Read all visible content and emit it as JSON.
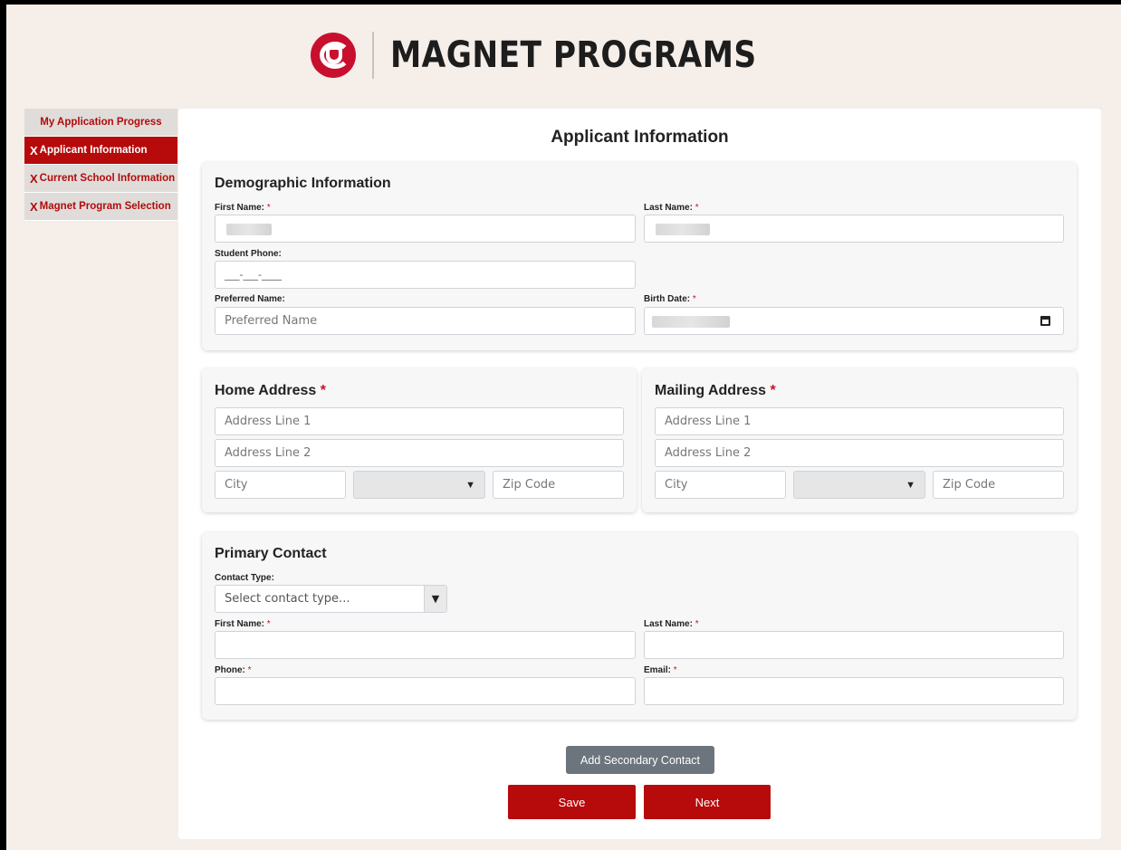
{
  "header": {
    "title": "MAGNET PROGRAMS"
  },
  "sidebar": {
    "items": [
      {
        "label": "My Application Progress",
        "mark": ""
      },
      {
        "label": "Applicant Information",
        "mark": "X"
      },
      {
        "label": "Current School Information",
        "mark": "X"
      },
      {
        "label": "Magnet Program Selection",
        "mark": "X"
      }
    ]
  },
  "page": {
    "title": "Applicant Information"
  },
  "demographic": {
    "title": "Demographic Information",
    "first_name_label": "First Name:",
    "last_name_label": "Last Name:",
    "student_phone_label": "Student Phone:",
    "student_phone_value": "___-___-____",
    "preferred_name_label": "Preferred Name:",
    "preferred_name_placeholder": "Preferred Name",
    "birth_date_label": "Birth Date:",
    "required_mark": "*"
  },
  "home_address": {
    "title": "Home Address",
    "line1_placeholder": "Address Line 1",
    "line2_placeholder": "Address Line 2",
    "city_placeholder": "City",
    "zip_placeholder": "Zip Code"
  },
  "mailing_address": {
    "title": "Mailing Address",
    "line1_placeholder": "Address Line 1",
    "line2_placeholder": "Address Line 2",
    "city_placeholder": "City",
    "zip_placeholder": "Zip Code"
  },
  "primary_contact": {
    "title": "Primary Contact",
    "contact_type_label": "Contact Type:",
    "contact_type_placeholder": "Select contact type...",
    "first_name_label": "First Name:",
    "last_name_label": "Last Name:",
    "phone_label": "Phone:",
    "email_label": "Email:"
  },
  "actions": {
    "add_secondary": "Add Secondary Contact",
    "save": "Save",
    "next": "Next"
  },
  "colors": {
    "accent": "#b70a0a",
    "background": "#f5eee9",
    "secondary_button": "#6c757d"
  },
  "icons": {
    "logo": "cherokee-c-logo-icon",
    "caret": "caret-down-icon",
    "calendar": "calendar-icon"
  }
}
